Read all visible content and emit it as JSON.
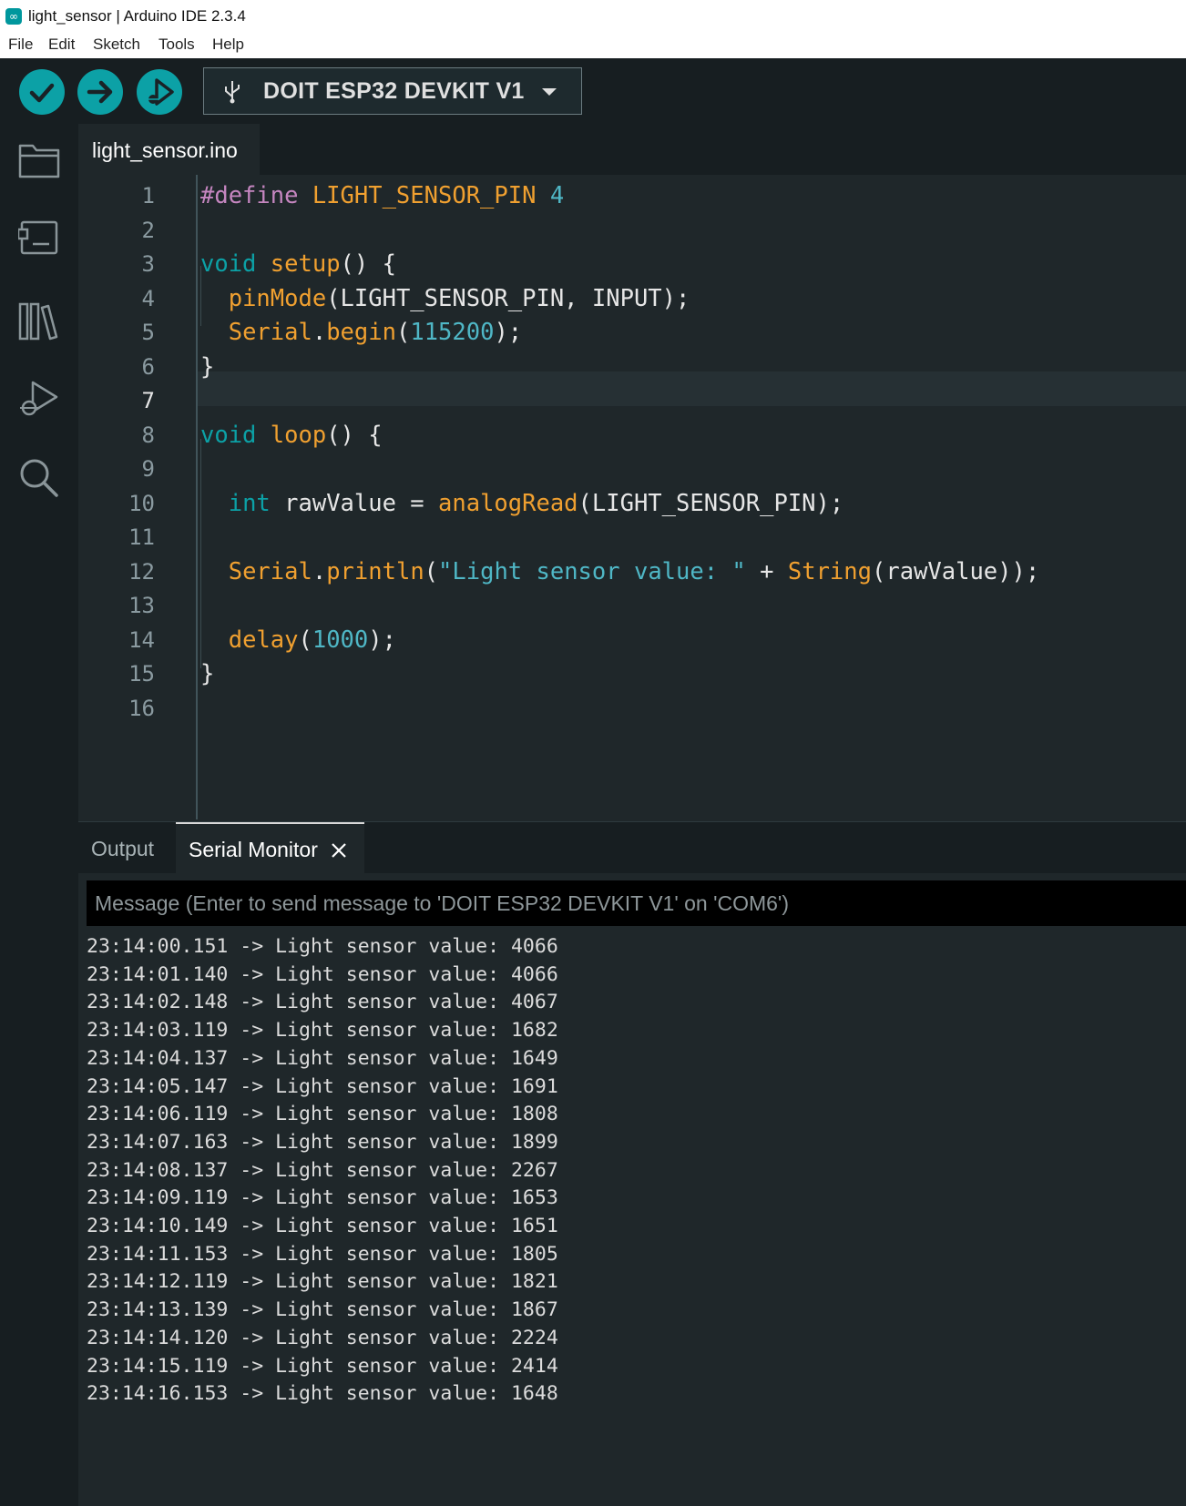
{
  "window": {
    "title": "light_sensor | Arduino IDE 2.3.4",
    "app_icon": "arduino-logo-icon",
    "app_icon_glyph": "∞"
  },
  "menu": [
    "File",
    "Edit",
    "Sketch",
    "Tools",
    "Help"
  ],
  "toolbar": {
    "verify_icon": "checkmark-icon",
    "upload_icon": "arrow-right-icon",
    "debug_icon": "debug-play-icon",
    "board": "DOIT ESP32 DEVKIT V1",
    "accent_color": "#0ca1a6"
  },
  "activity_bar": [
    "folder-icon",
    "board-manager-icon",
    "library-icon",
    "debug-icon",
    "search-icon"
  ],
  "editor": {
    "tab": "light_sensor.ino",
    "current_line": 7,
    "lines": [
      {
        "n": "1",
        "tokens": [
          {
            "t": "#define",
            "c": "pre"
          },
          {
            "t": " LIGHT_SENSOR_PIN ",
            "c": "fn"
          },
          {
            "t": "4",
            "c": "num"
          }
        ]
      },
      {
        "n": "2",
        "tokens": []
      },
      {
        "n": "3",
        "tokens": [
          {
            "t": "void",
            "c": "kw"
          },
          {
            "t": " ",
            "c": "plain"
          },
          {
            "t": "setup",
            "c": "fn"
          },
          {
            "t": "() {",
            "c": "plain"
          }
        ]
      },
      {
        "n": "4",
        "tokens": [
          {
            "t": "  ",
            "c": "plain"
          },
          {
            "t": "pinMode",
            "c": "fn"
          },
          {
            "t": "(LIGHT_SENSOR_PIN, INPUT);",
            "c": "plain"
          }
        ]
      },
      {
        "n": "5",
        "tokens": [
          {
            "t": "  ",
            "c": "plain"
          },
          {
            "t": "Serial",
            "c": "fn"
          },
          {
            "t": ".",
            "c": "plain"
          },
          {
            "t": "begin",
            "c": "fn"
          },
          {
            "t": "(",
            "c": "plain"
          },
          {
            "t": "115200",
            "c": "num"
          },
          {
            "t": ");",
            "c": "plain"
          }
        ]
      },
      {
        "n": "6",
        "tokens": [
          {
            "t": "}",
            "c": "plain"
          }
        ]
      },
      {
        "n": "7",
        "tokens": []
      },
      {
        "n": "8",
        "tokens": [
          {
            "t": "void",
            "c": "kw"
          },
          {
            "t": " ",
            "c": "plain"
          },
          {
            "t": "loop",
            "c": "fn"
          },
          {
            "t": "() {",
            "c": "plain"
          }
        ]
      },
      {
        "n": "9",
        "tokens": []
      },
      {
        "n": "10",
        "tokens": [
          {
            "t": "  ",
            "c": "plain"
          },
          {
            "t": "int",
            "c": "kw"
          },
          {
            "t": " rawValue = ",
            "c": "plain"
          },
          {
            "t": "analogRead",
            "c": "fn"
          },
          {
            "t": "(LIGHT_SENSOR_PIN);",
            "c": "plain"
          }
        ]
      },
      {
        "n": "11",
        "tokens": []
      },
      {
        "n": "12",
        "tokens": [
          {
            "t": "  ",
            "c": "plain"
          },
          {
            "t": "Serial",
            "c": "fn"
          },
          {
            "t": ".",
            "c": "plain"
          },
          {
            "t": "println",
            "c": "fn"
          },
          {
            "t": "(",
            "c": "plain"
          },
          {
            "t": "\"Light sensor value: \"",
            "c": "str"
          },
          {
            "t": " + ",
            "c": "plain"
          },
          {
            "t": "String",
            "c": "fn"
          },
          {
            "t": "(rawValue));",
            "c": "plain"
          }
        ]
      },
      {
        "n": "13",
        "tokens": []
      },
      {
        "n": "14",
        "tokens": [
          {
            "t": "  ",
            "c": "plain"
          },
          {
            "t": "delay",
            "c": "fn"
          },
          {
            "t": "(",
            "c": "plain"
          },
          {
            "t": "1000",
            "c": "num"
          },
          {
            "t": ");",
            "c": "plain"
          }
        ]
      },
      {
        "n": "15",
        "tokens": [
          {
            "t": "}",
            "c": "plain"
          }
        ]
      },
      {
        "n": "16",
        "tokens": []
      }
    ]
  },
  "panel": {
    "tabs": {
      "output": "Output",
      "serial": "Serial Monitor"
    },
    "close_icon": "close-icon",
    "message_placeholder": "Message (Enter to send message to 'DOIT ESP32 DEVKIT V1' on 'COM6')",
    "serial_lines": [
      "23:14:00.151 -> Light sensor value: 4066",
      "23:14:01.140 -> Light sensor value: 4066",
      "23:14:02.148 -> Light sensor value: 4067",
      "23:14:03.119 -> Light sensor value: 1682",
      "23:14:04.137 -> Light sensor value: 1649",
      "23:14:05.147 -> Light sensor value: 1691",
      "23:14:06.119 -> Light sensor value: 1808",
      "23:14:07.163 -> Light sensor value: 1899",
      "23:14:08.137 -> Light sensor value: 2267",
      "23:14:09.119 -> Light sensor value: 1653",
      "23:14:10.149 -> Light sensor value: 1651",
      "23:14:11.153 -> Light sensor value: 1805",
      "23:14:12.119 -> Light sensor value: 1821",
      "23:14:13.139 -> Light sensor value: 1867",
      "23:14:14.120 -> Light sensor value: 2224",
      "23:14:15.119 -> Light sensor value: 2414",
      "23:14:16.153 -> Light sensor value: 1648"
    ]
  }
}
